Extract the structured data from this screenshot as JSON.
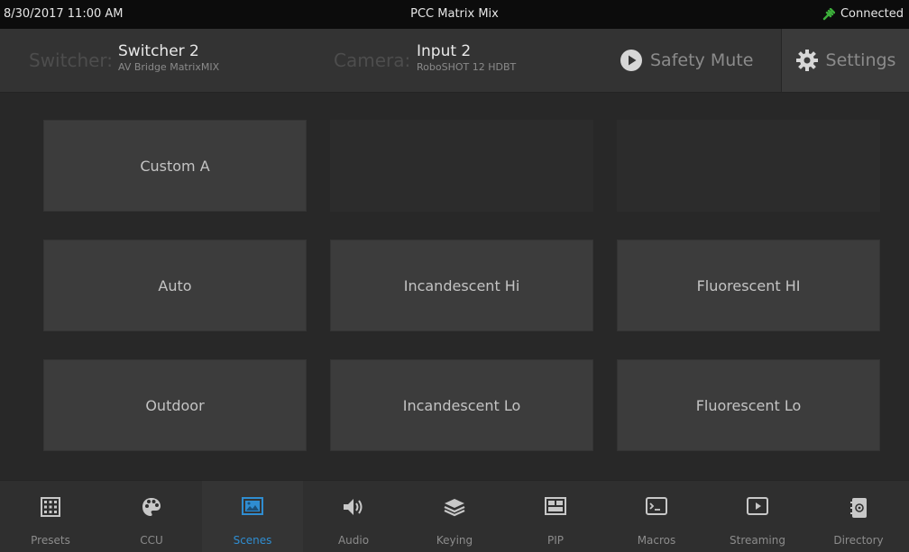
{
  "titlebar": {
    "datetime": "8/30/2017 11:00 AM",
    "title": "PCC Matrix Mix",
    "status": "Connected",
    "status_color": "#3cae3a"
  },
  "header": {
    "switcher_label": "Switcher:",
    "switcher_name": "Switcher 2",
    "switcher_model": "AV Bridge MatrixMIX",
    "camera_label": "Camera:",
    "camera_name": "Input 2",
    "camera_model": "RoboSHOT 12 HDBT",
    "safety_mute_label": "Safety Mute",
    "safety_mute_icon": "play-circle-icon",
    "settings_label": "Settings",
    "settings_icon": "gear-icon"
  },
  "scenes": {
    "row1": [
      "Custom A",
      "",
      ""
    ],
    "row2": [
      "Auto",
      "Incandescent Hi",
      "Fluorescent HI"
    ],
    "row3": [
      "Outdoor",
      "Incandescent Lo",
      "Fluorescent Lo"
    ]
  },
  "nav": {
    "active": "Scenes",
    "active_color": "#2f8dd1",
    "items": [
      {
        "label": "Presets",
        "icon": "grid-icon"
      },
      {
        "label": "CCU",
        "icon": "palette-icon"
      },
      {
        "label": "Scenes",
        "icon": "picture-icon"
      },
      {
        "label": "Audio",
        "icon": "speaker-icon"
      },
      {
        "label": "Keying",
        "icon": "layers-icon"
      },
      {
        "label": "PIP",
        "icon": "pip-icon"
      },
      {
        "label": "Macros",
        "icon": "terminal-icon"
      },
      {
        "label": "Streaming",
        "icon": "play-square-icon"
      },
      {
        "label": "Directory",
        "icon": "address-book-icon"
      }
    ]
  }
}
